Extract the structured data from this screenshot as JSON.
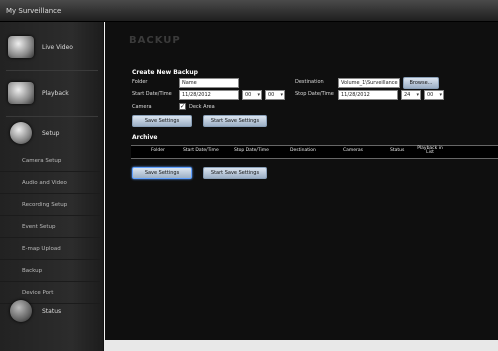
{
  "app": {
    "title": "My Surveillance"
  },
  "sidebar": {
    "main": [
      {
        "label": "Live Video",
        "icon": "camera-icon"
      },
      {
        "label": "Playback",
        "icon": "playback-icon"
      },
      {
        "label": "Setup",
        "icon": "gear-icon"
      }
    ],
    "setup_items": [
      "Camera Setup",
      "Audio and Video",
      "Recording Setup",
      "Event Setup",
      "E-map Upload",
      "Backup",
      "Device Port"
    ],
    "status": {
      "label": "Status",
      "icon": "status-icon"
    }
  },
  "page": {
    "heading": "BACKUP"
  },
  "create": {
    "title": "Create New Backup",
    "folder_label": "Folder",
    "folder_value": "Name",
    "destination_label": "Destination",
    "destination_value": "Volume_1\\Surveillance",
    "browse_label": "Browse...",
    "start_label": "Start Date/Time",
    "start_date": "11/28/2012",
    "start_hour": "00",
    "start_min": "00",
    "stop_label": "Stop Date/Time",
    "stop_date": "11/28/2012",
    "stop_hour": "24",
    "stop_min": "00",
    "camera_label": "Camera",
    "camera_check": "✓",
    "camera_value": "Deck Area",
    "save_settings": "Save Settings",
    "start_backup": "Start Save Settings"
  },
  "archive": {
    "title": "Archive",
    "columns": [
      "Folder",
      "Start Date/Time",
      "Stop Date/Time",
      "Destination",
      "Cameras",
      "Status",
      "Playback in List"
    ],
    "save_settings": "Save Settings",
    "start_backup": "Start Save Settings"
  }
}
